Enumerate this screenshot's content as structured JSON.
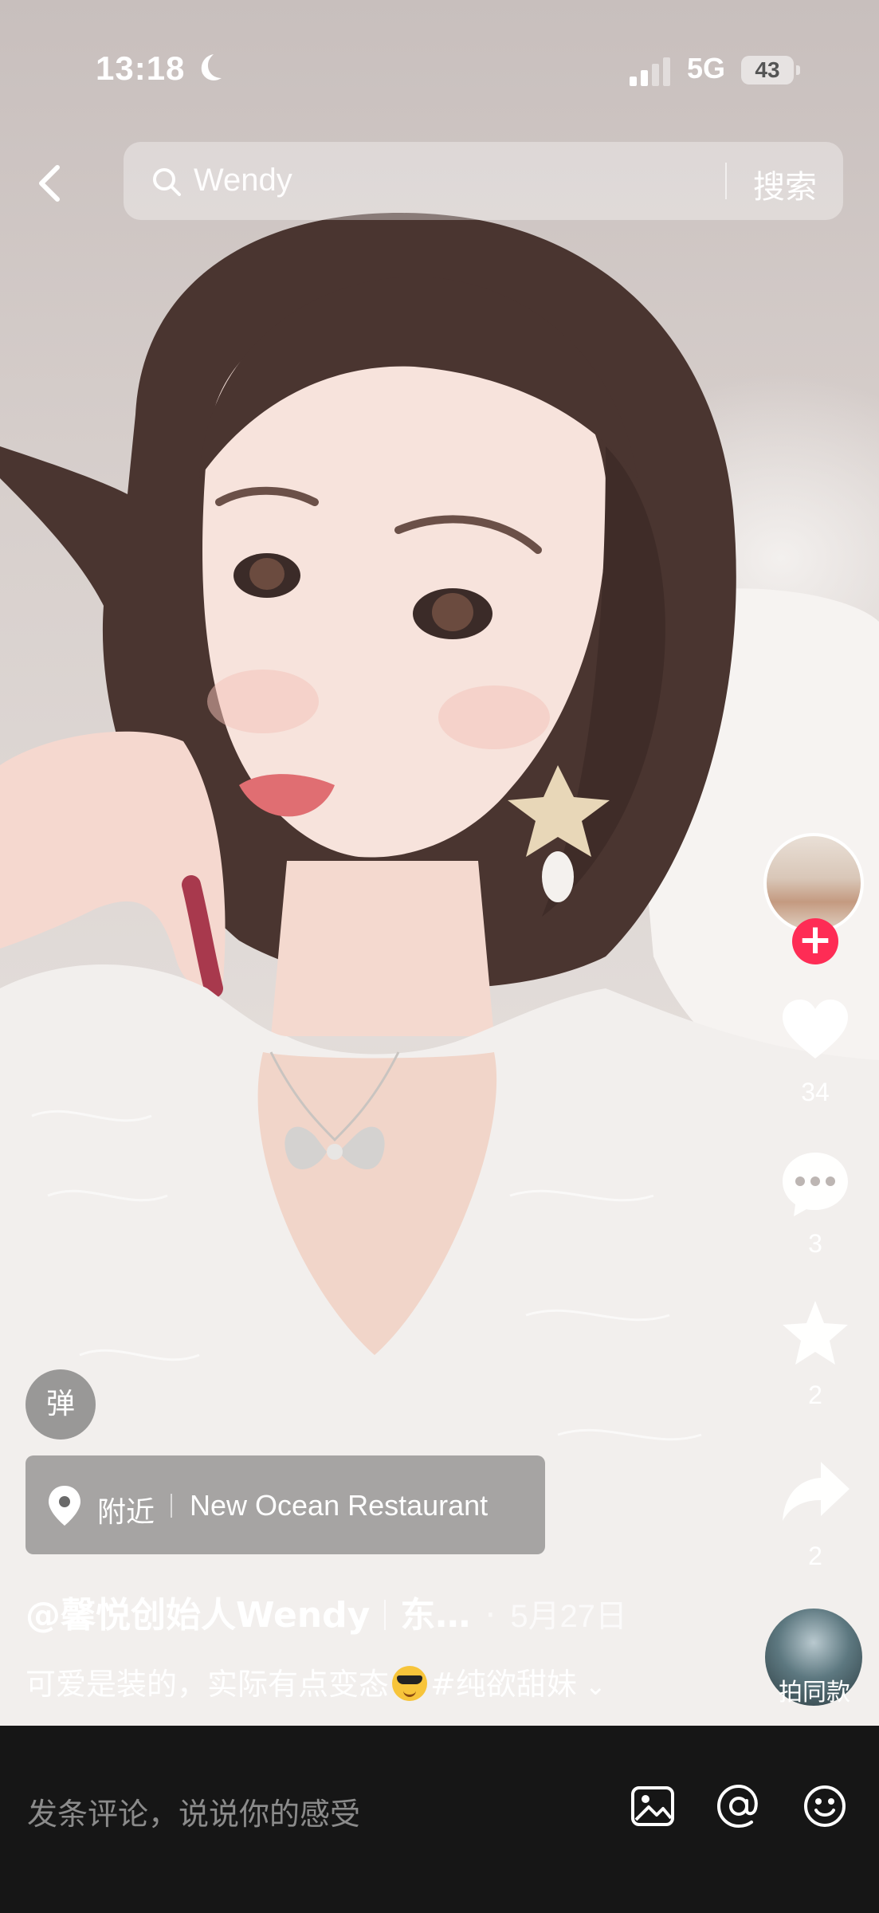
{
  "status_bar": {
    "time": "13:18",
    "network": "5G",
    "battery": "43",
    "icons": [
      "moon-icon",
      "signal-icon",
      "battery-icon"
    ]
  },
  "search": {
    "placeholder": "Wendy",
    "button_label": "搜索",
    "icons": [
      "back-icon",
      "search-icon"
    ]
  },
  "rail": {
    "likes": "34",
    "comments": "3",
    "favorites": "2",
    "shares": "2",
    "same_style_label": "拍同款",
    "follow_symbol": "+",
    "icons": [
      "heart-icon",
      "comment-icon",
      "star-icon",
      "share-icon"
    ]
  },
  "danmu_label": "弹",
  "location": {
    "label": "附近",
    "place": "New Ocean Restaurant",
    "icon": "location-pin-icon"
  },
  "post": {
    "author": "@馨悦创始人Wendy",
    "author_suffix": "东…",
    "date": "5月27日",
    "caption_text": "可爱是装的，实际有点变态",
    "hashtag": "#纯欲甜妹",
    "emoji": "sunglasses-emoji"
  },
  "comment_bar": {
    "placeholder": "发条评论，说说你的感受",
    "icons": [
      "image-icon",
      "at-icon",
      "emoji-icon"
    ]
  },
  "colors": {
    "follow_red": "#fe2c55",
    "bottom_bar": "#161616"
  }
}
